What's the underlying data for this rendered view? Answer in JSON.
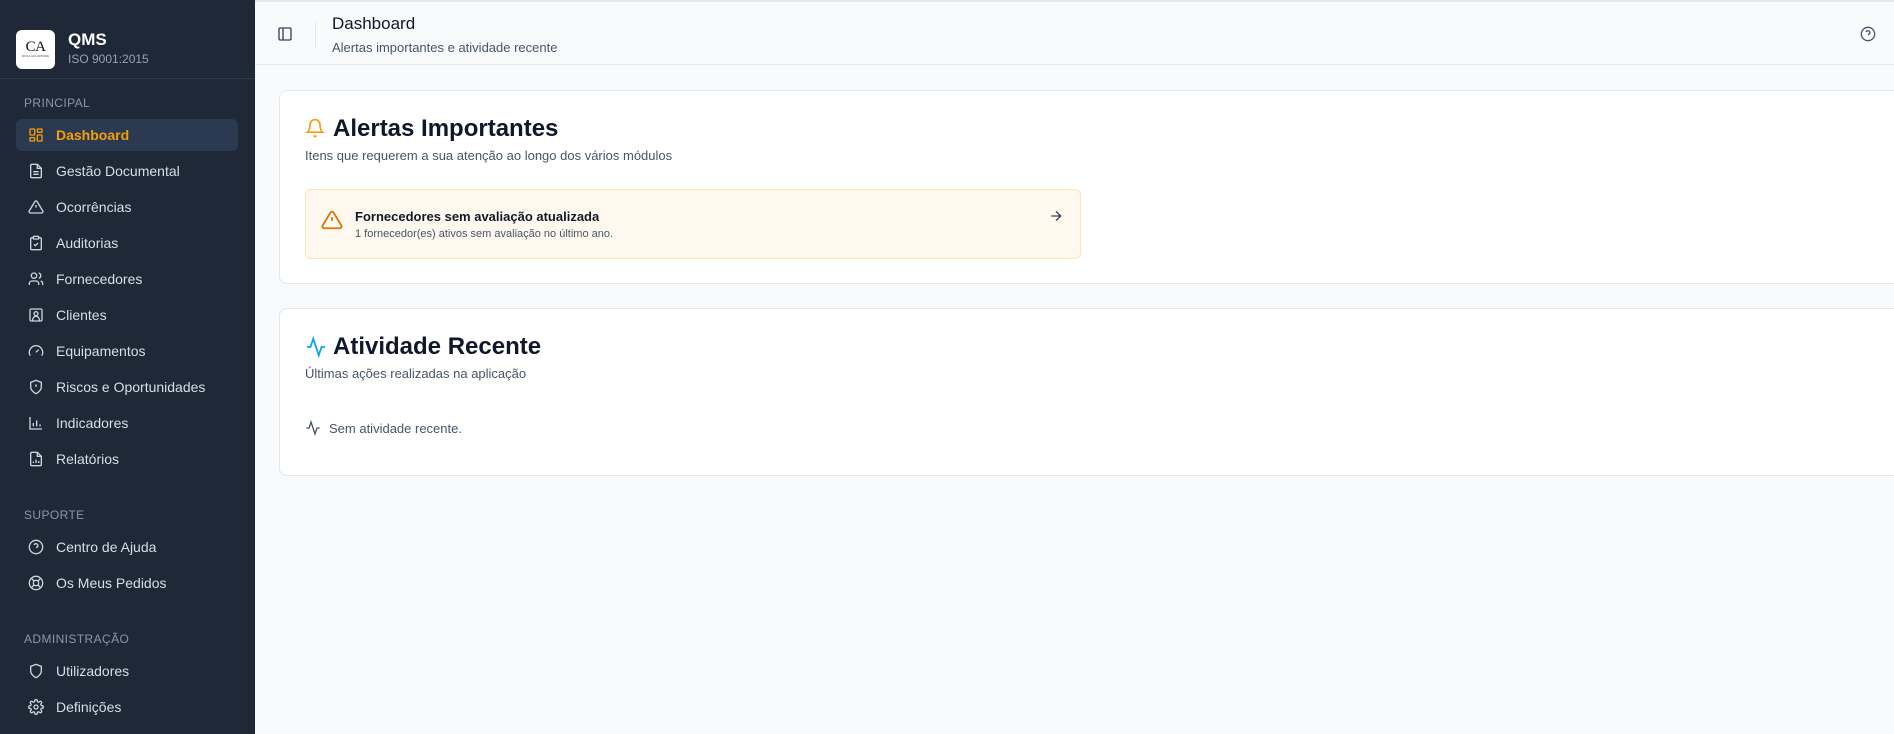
{
  "brand": {
    "logo_text": "CA",
    "logo_sub": "ROSA AGUAPRIME",
    "title": "QMS",
    "subtitle": "ISO 9001:2015"
  },
  "sidebar": {
    "sections": [
      {
        "label": "PRINCIPAL"
      },
      {
        "label": "SUPORTE"
      },
      {
        "label": "ADMINISTRAÇÃO"
      }
    ],
    "items": [
      {
        "label": "Dashboard",
        "icon": "grid-icon",
        "active": true
      },
      {
        "label": "Gestão Documental",
        "icon": "document-icon"
      },
      {
        "label": "Ocorrências",
        "icon": "warning-icon"
      },
      {
        "label": "Auditorias",
        "icon": "clipboard-check-icon"
      },
      {
        "label": "Fornecedores",
        "icon": "users-icon"
      },
      {
        "label": "Clientes",
        "icon": "contact-icon"
      },
      {
        "label": "Equipamentos",
        "icon": "gauge-icon"
      },
      {
        "label": "Riscos e Oportunidades",
        "icon": "shield-alert-icon"
      },
      {
        "label": "Indicadores",
        "icon": "bar-chart-icon"
      },
      {
        "label": "Relatórios",
        "icon": "report-icon"
      },
      {
        "label": "Centro de Ajuda",
        "icon": "help-circle-icon"
      },
      {
        "label": "Os Meus Pedidos",
        "icon": "lifebuoy-icon"
      },
      {
        "label": "Utilizadores",
        "icon": "shield-icon"
      },
      {
        "label": "Definições",
        "icon": "gear-icon"
      }
    ]
  },
  "header": {
    "title": "Dashboard",
    "subtitle": "Alertas importantes e atividade recente"
  },
  "alerts_card": {
    "title": "Alertas Importantes",
    "subtitle": "Itens que requerem a sua atenção ao longo dos vários módulos",
    "alert": {
      "title": "Fornecedores sem avaliação atualizada",
      "description": "1 fornecedor(es) ativos sem avaliação no último ano."
    }
  },
  "activity_card": {
    "title": "Atividade Recente",
    "subtitle": "Últimas ações realizadas na aplicação",
    "empty_text": "Sem atividade recente."
  },
  "colors": {
    "sidebar_bg": "#1e2837",
    "accent": "#f59e0b",
    "activity_accent": "#0ea5e9"
  }
}
